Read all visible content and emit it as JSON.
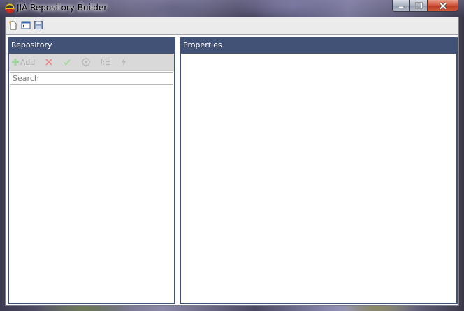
{
  "window": {
    "title": "JIA Repository Builder",
    "app_icon": "flame-colored-app-icon",
    "controls": [
      "minimize-icon",
      "maximize-icon",
      "close-icon"
    ]
  },
  "toolbar": {
    "items": [
      {
        "name": "new-document-icon"
      },
      {
        "name": "open-console-icon"
      },
      {
        "name": "save-disk-icon"
      }
    ]
  },
  "repository": {
    "header": "Repository",
    "toolbar": {
      "add_label": "Add",
      "buttons": [
        "plus-icon",
        "delete-x-icon",
        "check-icon",
        "settings-target-icon",
        "list-icon",
        "lightning-icon"
      ]
    },
    "search": {
      "placeholder": "Search",
      "value": ""
    }
  },
  "properties": {
    "header": "Properties"
  },
  "colors": {
    "panel_header": "#425277",
    "toolbar_bg": "#d9d9da",
    "client_bg": "#ebebec",
    "add_green": "#9fd39a",
    "delete_red": "#f08a8a",
    "check_green": "#a7d99a"
  }
}
